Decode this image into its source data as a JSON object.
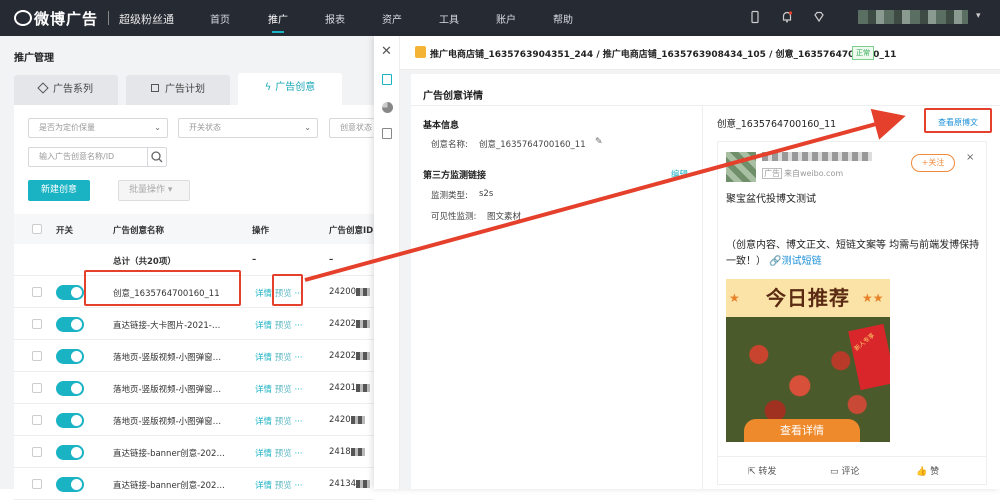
{
  "nav": {
    "logo_text": "微博广告",
    "logo_sub": "超级粉丝通",
    "items": [
      "首页",
      "推广",
      "报表",
      "资产",
      "工具",
      "账户",
      "帮助"
    ],
    "active": "推广"
  },
  "left": {
    "title": "推广管理",
    "tabs": [
      "广告系列",
      "广告计划",
      "广告创意"
    ],
    "active_tab": "广告创意",
    "filters": {
      "price": "是否为定价保量",
      "switch": "开关状态",
      "status": "创意状态",
      "search_placeholder": "输入广告创意名称/ID"
    },
    "btn_new": "新建创意",
    "btn_batch": "批量操作",
    "columns": [
      "开关",
      "广告创意名称",
      "操作",
      "广告创意ID"
    ],
    "total_label": "总计（共20项）",
    "total_dash1": "–",
    "total_dash2": "–",
    "op_detail": "详情",
    "op_preview": "预览",
    "op_more": "···",
    "rows": [
      {
        "name": "创意_1635764700160_11",
        "id": "24200"
      },
      {
        "name": "直达链接-大卡图片-2021-…",
        "id": "24202"
      },
      {
        "name": "落地页-竖版视频-小图弹窗…",
        "id": "24202"
      },
      {
        "name": "落地页-竖版视频-小图弹窗…",
        "id": "24201"
      },
      {
        "name": "落地页-竖版视频-小图弹窗…",
        "id": "2420"
      },
      {
        "name": "直达链接-banner创意-202…",
        "id": "2418"
      },
      {
        "name": "直达链接-banner创意-202…",
        "id": "24134"
      }
    ]
  },
  "right": {
    "breadcrumb": "推广电商店铺_1635763904351_244 / 推广电商店铺_1635763908434_105 / 创意_1635764700160_11",
    "status": "正常",
    "detail_title": "广告创意详情",
    "basic_title": "基本信息",
    "name_label": "创意名称:",
    "name_value": "创意_1635764700160_11",
    "monitor_title": "第三方监测链接",
    "edit": "编辑",
    "type_label": "监测类型:",
    "type_value": "s2s",
    "vis_label": "可见性监测:",
    "vis_value": "图文素材",
    "preview_name": "创意_1635764700160_11",
    "view_original": "查看原博文",
    "post": {
      "ad_tag": "广告",
      "source": "来自weibo.com",
      "follow": "+关注",
      "title": "聚宝盆代投博文测试",
      "body": "（创意内容、博文正文、短链文案等 均需与前端发博保持一致！）",
      "link": "测试短链",
      "banner": "今日推荐",
      "cta": "查看详情",
      "repost": "转发",
      "comment": "评论",
      "like": "赞",
      "sticker": "新人专享"
    }
  },
  "colors": {
    "accent": "#1ab3c4",
    "nav_bg": "#262a33",
    "annotation": "#e5402b"
  }
}
